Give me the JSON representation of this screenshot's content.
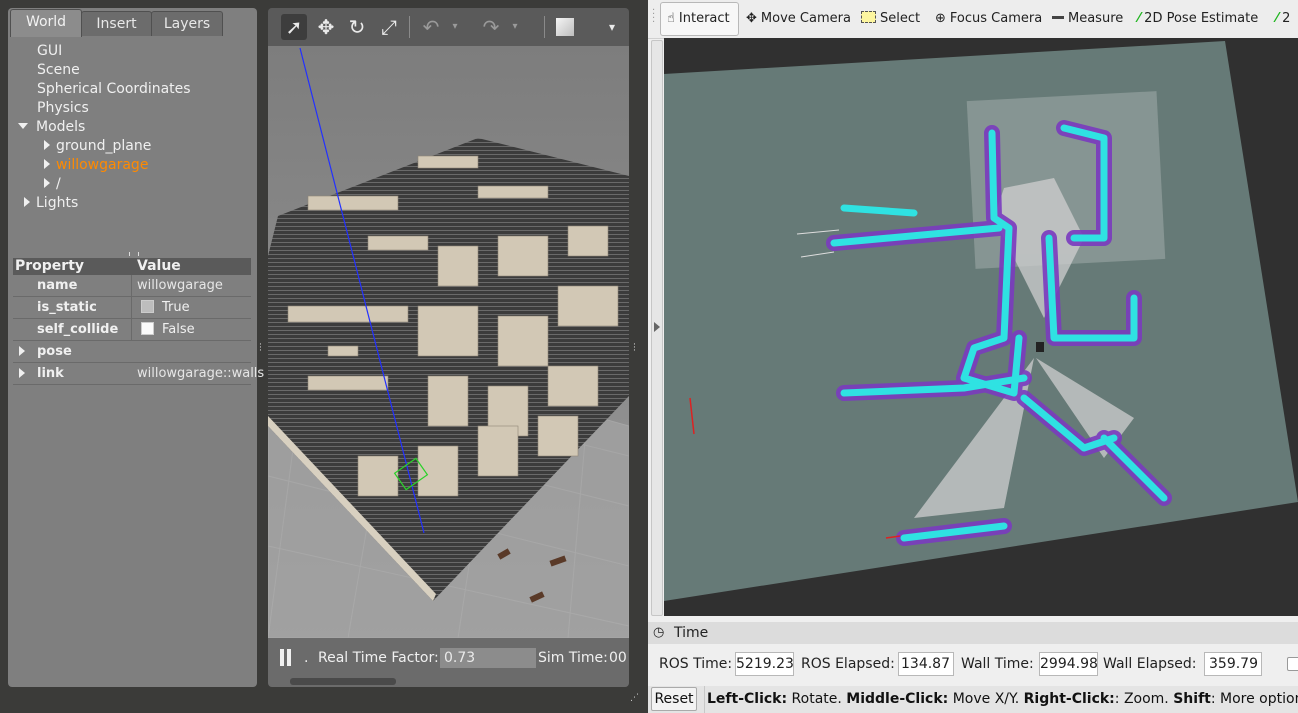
{
  "gazebo": {
    "tabs": [
      "World",
      "Insert",
      "Layers"
    ],
    "tree": {
      "gui": "GUI",
      "scene": "Scene",
      "spherical": "Spherical Coordinates",
      "physics": "Physics",
      "models": "Models",
      "ground_plane": "ground_plane",
      "willowgarage": "willowgarage",
      "slash": "/",
      "lights": "Lights"
    },
    "properties": {
      "header_property": "Property",
      "header_value": "Value",
      "rows": [
        {
          "key": "name",
          "value": "willowgarage"
        },
        {
          "key": "is_static",
          "value": "True",
          "checked": true
        },
        {
          "key": "self_collide",
          "value": "False",
          "checked": false
        },
        {
          "key": "pose",
          "value": ""
        },
        {
          "key": "link",
          "value": "willowgarage::walls"
        }
      ]
    },
    "bottom": {
      "rtf_label": "Real Time Factor:",
      "rtf_value": "0.73",
      "sim_time_label": "Sim Time:",
      "sim_time_value": "00"
    }
  },
  "rviz": {
    "tools": {
      "interact": "Interact",
      "move_camera": "Move Camera",
      "select": "Select",
      "focus_camera": "Focus Camera",
      "measure": "Measure",
      "pose_estimate": "2D Pose Estimate",
      "extra": "2"
    },
    "time_panel": {
      "title": "Time",
      "ros_time_label": "ROS Time:",
      "ros_time_value": "5219.23",
      "ros_elapsed_label": "ROS Elapsed:",
      "ros_elapsed_value": "134.87",
      "wall_time_label": "Wall Time:",
      "wall_time_value": "2994.98",
      "wall_elapsed_label": "Wall Elapsed:",
      "wall_elapsed_value": "359.79"
    },
    "status": {
      "reset": "Reset",
      "hint_b1": "Left-Click:",
      "hint_t1": " Rotate. ",
      "hint_b2": "Middle-Click:",
      "hint_t2": " Move X/Y. ",
      "hint_b3": "Right-Click:",
      "hint_t3": ": Zoom. ",
      "hint_b4": "Shift",
      "hint_t4": ": More options."
    }
  }
}
